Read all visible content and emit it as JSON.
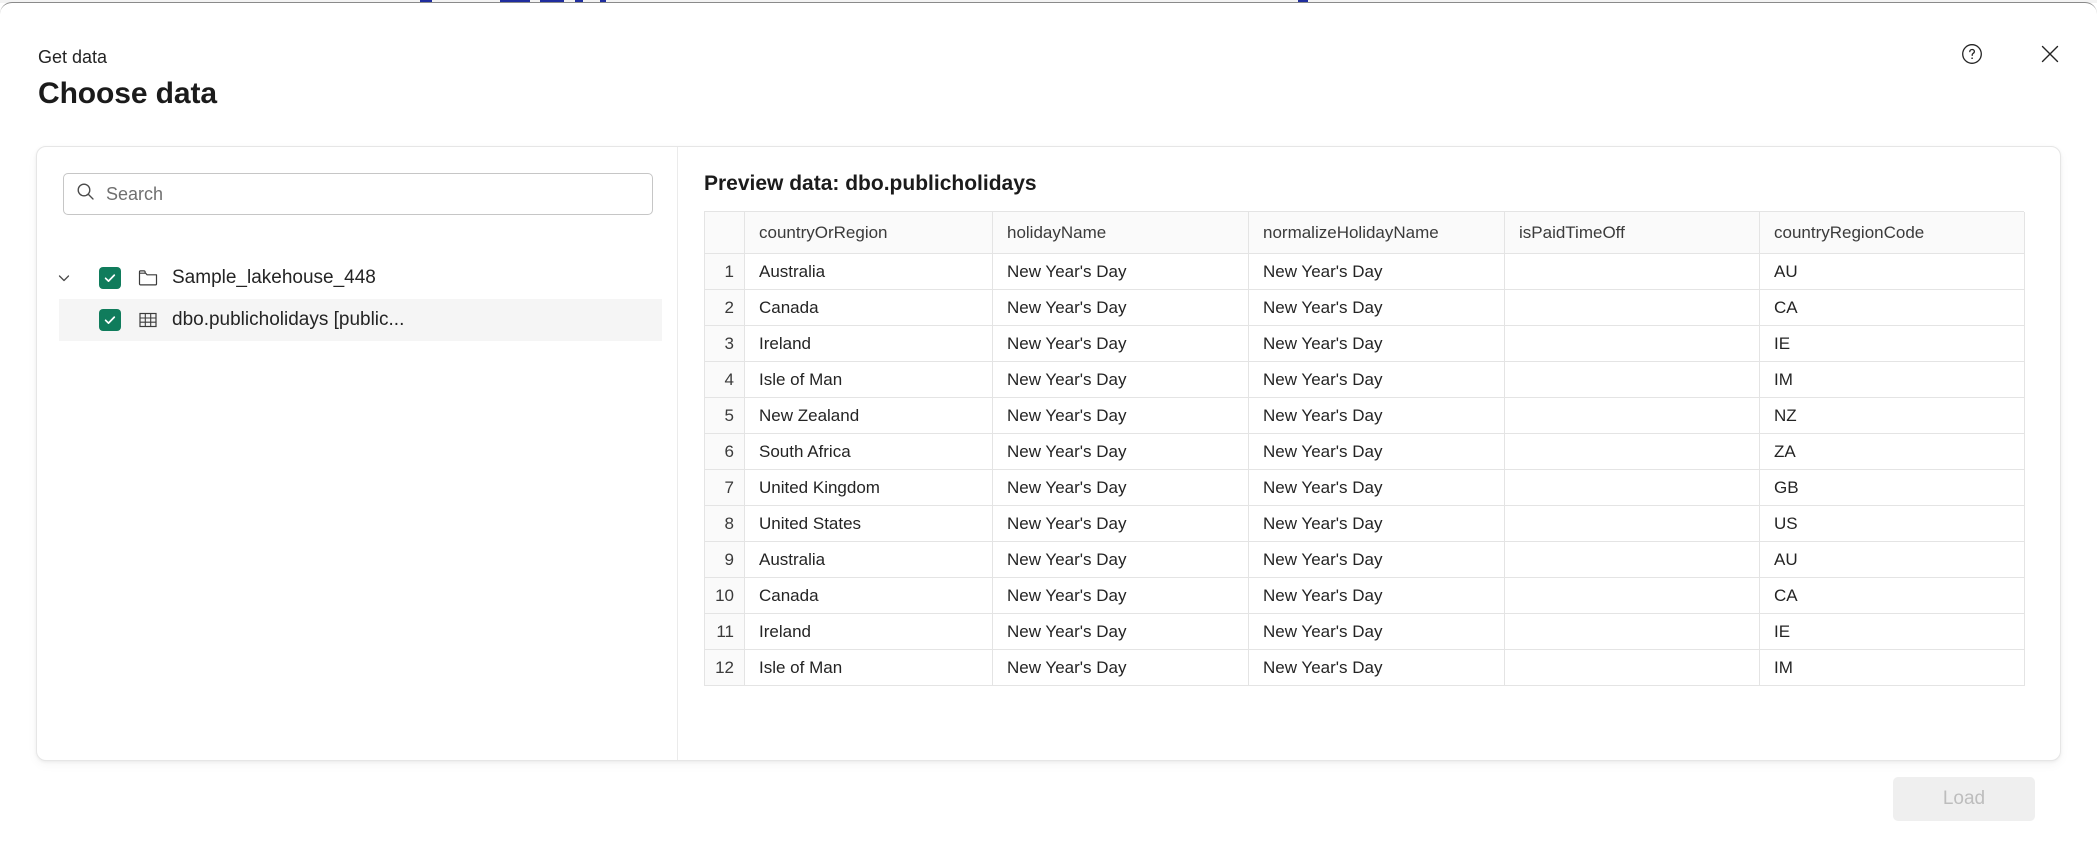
{
  "dialog": {
    "breadcrumb": "Get data",
    "title": "Choose data",
    "help_icon": "help-circle-icon",
    "close_icon": "close-icon"
  },
  "search": {
    "placeholder": "Search",
    "value": "",
    "icon": "search-icon"
  },
  "tree": {
    "items": [
      {
        "label": "Sample_lakehouse_448",
        "icon": "folder-icon",
        "checked": true,
        "expanded": true,
        "level": 0,
        "selected": false
      },
      {
        "label": "dbo.publicholidays [public...",
        "icon": "table-icon",
        "checked": true,
        "level": 1,
        "selected": true
      }
    ]
  },
  "preview": {
    "title": "Preview data: dbo.publicholidays",
    "columns": [
      "countryOrRegion",
      "holidayName",
      "normalizeHolidayName",
      "isPaidTimeOff",
      "countryRegionCode"
    ],
    "rows": [
      {
        "n": "1",
        "cells": [
          "Australia",
          "New Year's Day",
          "New Year's Day",
          "",
          "AU"
        ]
      },
      {
        "n": "2",
        "cells": [
          "Canada",
          "New Year's Day",
          "New Year's Day",
          "",
          "CA"
        ]
      },
      {
        "n": "3",
        "cells": [
          "Ireland",
          "New Year's Day",
          "New Year's Day",
          "",
          "IE"
        ]
      },
      {
        "n": "4",
        "cells": [
          "Isle of Man",
          "New Year's Day",
          "New Year's Day",
          "",
          "IM"
        ]
      },
      {
        "n": "5",
        "cells": [
          "New Zealand",
          "New Year's Day",
          "New Year's Day",
          "",
          "NZ"
        ]
      },
      {
        "n": "6",
        "cells": [
          "South Africa",
          "New Year's Day",
          "New Year's Day",
          "",
          "ZA"
        ]
      },
      {
        "n": "7",
        "cells": [
          "United Kingdom",
          "New Year's Day",
          "New Year's Day",
          "",
          "GB"
        ]
      },
      {
        "n": "8",
        "cells": [
          "United States",
          "New Year's Day",
          "New Year's Day",
          "",
          "US"
        ]
      },
      {
        "n": "9",
        "cells": [
          "Australia",
          "New Year's Day",
          "New Year's Day",
          "",
          "AU"
        ]
      },
      {
        "n": "10",
        "cells": [
          "Canada",
          "New Year's Day",
          "New Year's Day",
          "",
          "CA"
        ]
      },
      {
        "n": "11",
        "cells": [
          "Ireland",
          "New Year's Day",
          "New Year's Day",
          "",
          "IE"
        ]
      },
      {
        "n": "12",
        "cells": [
          "Isle of Man",
          "New Year's Day",
          "New Year's Day",
          "",
          "IM"
        ]
      }
    ]
  },
  "footer": {
    "load_label": "Load",
    "load_disabled": true
  },
  "colors": {
    "checkbox_green": "#107c5c",
    "selected_row_bg": "#f5f5f5",
    "grid_line": "#e4e4e4",
    "header_bg": "#fafafa",
    "disabled_button_bg": "#efefef",
    "disabled_button_text": "#bdbdbd"
  }
}
